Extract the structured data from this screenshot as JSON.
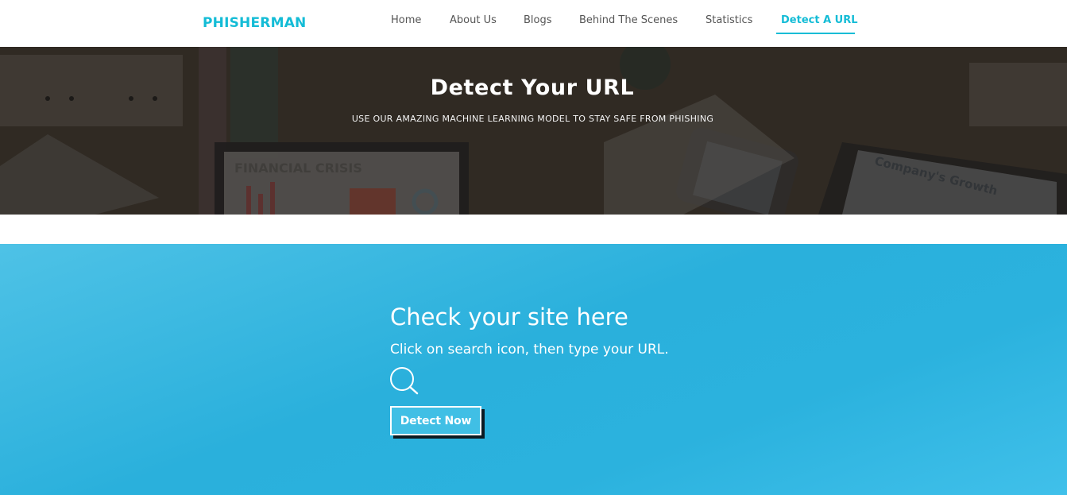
{
  "header": {
    "logo": "PHISHERMAN",
    "nav": [
      {
        "label": "Home"
      },
      {
        "label": "About Us"
      },
      {
        "label": "Blogs"
      },
      {
        "label": "Behind The Scenes"
      },
      {
        "label": "Statistics"
      },
      {
        "label": "Detect A URL",
        "active": true
      }
    ]
  },
  "hero": {
    "title": "Detect Your URL",
    "subtitle": "USE OUR AMAZING MACHINE LEARNING MODEL TO STAY SAFE FROM PHISHING",
    "background_text_1": "FINANCIAL CRISIS",
    "background_text_2": "Company's Growth"
  },
  "detect": {
    "title": "Check your site here",
    "description": "Click on search icon, then type your URL.",
    "search_icon": "search-icon",
    "button_label": "Detect Now"
  },
  "colors": {
    "brand": "#14bcd6",
    "section_bg": "#2ab0dc",
    "hero_overlay": "#2b2622"
  }
}
